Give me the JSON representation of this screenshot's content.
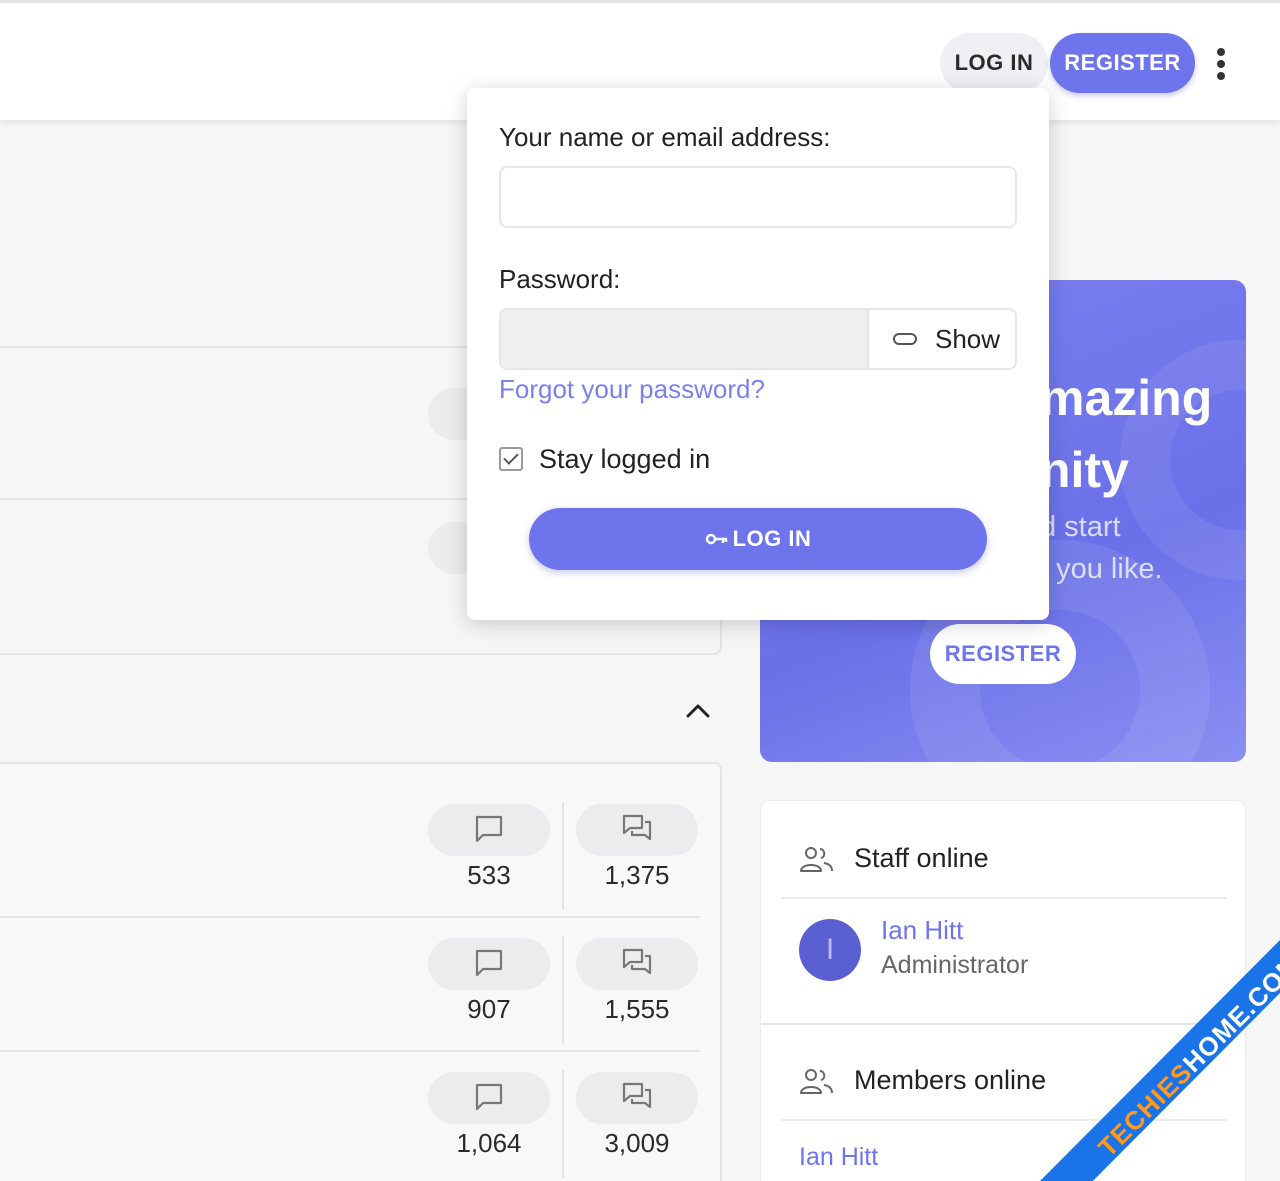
{
  "header": {
    "login_label": "LOG IN",
    "register_label": "REGISTER",
    "more_icon": "kebab-vertical-icon"
  },
  "login_popup": {
    "name_label": "Your name or email address:",
    "name_value": "",
    "password_label": "Password:",
    "password_value": "",
    "show_label": "Show",
    "forgot_label": "Forgot your password?",
    "stay_logged_label": "Stay logged in",
    "stay_logged_checked": true,
    "submit_label": "LOG IN"
  },
  "banner": {
    "heading_line1": "mazing",
    "heading_line2": "nity",
    "text_line1": "d start",
    "text_line2": "t you like.",
    "register_label": "REGISTER"
  },
  "forum_stats": [
    {
      "threads": "533",
      "messages": "1,375"
    },
    {
      "threads": "907",
      "messages": "1,555"
    },
    {
      "threads": "1,064",
      "messages": "3,009"
    }
  ],
  "online": {
    "staff_title": "Staff online",
    "staff": [
      {
        "initial": "I",
        "name": "Ian Hitt",
        "role": "Administrator"
      }
    ],
    "members_title": "Members online",
    "members": [
      "Ian Hitt"
    ]
  },
  "watermark": {
    "part1": "TECHIES",
    "part2": "HOME.COM"
  },
  "colors": {
    "accent": "#6e74ec",
    "link": "#7a80f0",
    "avatar": "#5a60d2"
  }
}
